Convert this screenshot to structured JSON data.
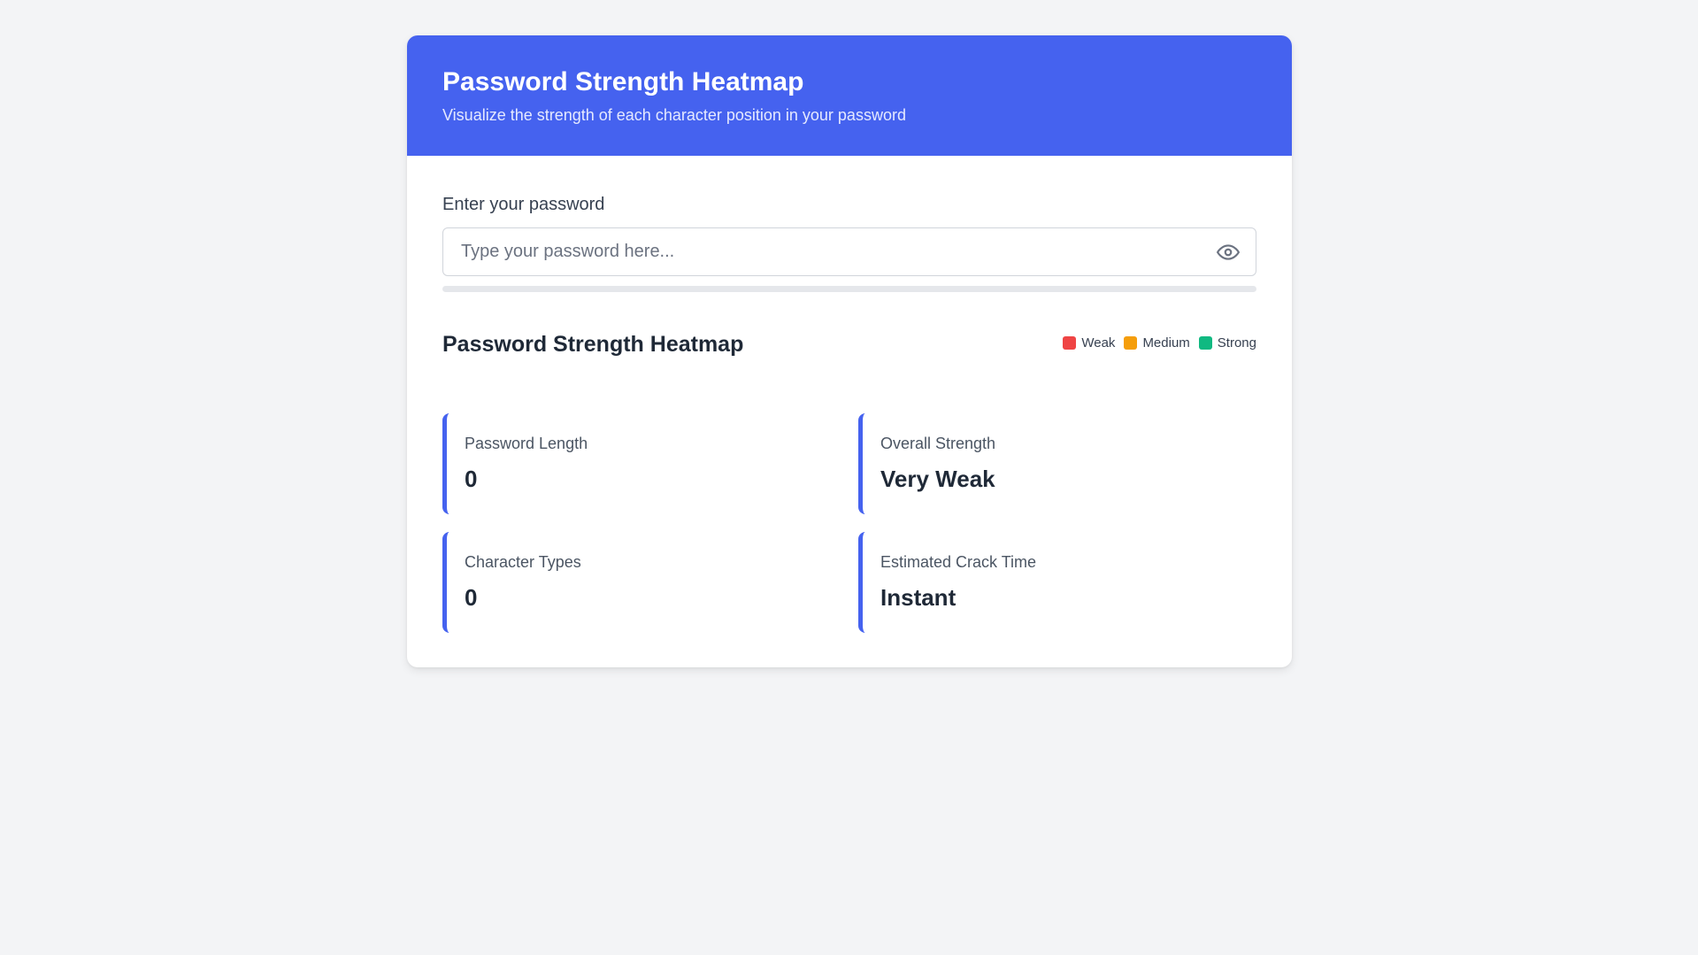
{
  "header": {
    "title": "Password Strength Heatmap",
    "subtitle": "Visualize the strength of each character position in your password"
  },
  "password": {
    "label": "Enter your password",
    "placeholder": "Type your password here...",
    "value": "",
    "toggle_icon": "eye-icon",
    "strength_fraction": 0
  },
  "heatmap": {
    "title": "Password Strength Heatmap",
    "legend": [
      {
        "label": "Weak",
        "color": "#ef4444"
      },
      {
        "label": "Medium",
        "color": "#f59e0b"
      },
      {
        "label": "Strong",
        "color": "#10b981"
      }
    ]
  },
  "stats": [
    {
      "label": "Password Length",
      "value": "0"
    },
    {
      "label": "Overall Strength",
      "value": "Very Weak"
    },
    {
      "label": "Character Types",
      "value": "0"
    },
    {
      "label": "Estimated Crack Time",
      "value": "Instant"
    }
  ],
  "colors": {
    "accent": "#4562ef",
    "page_background": "#f3f4f6"
  }
}
